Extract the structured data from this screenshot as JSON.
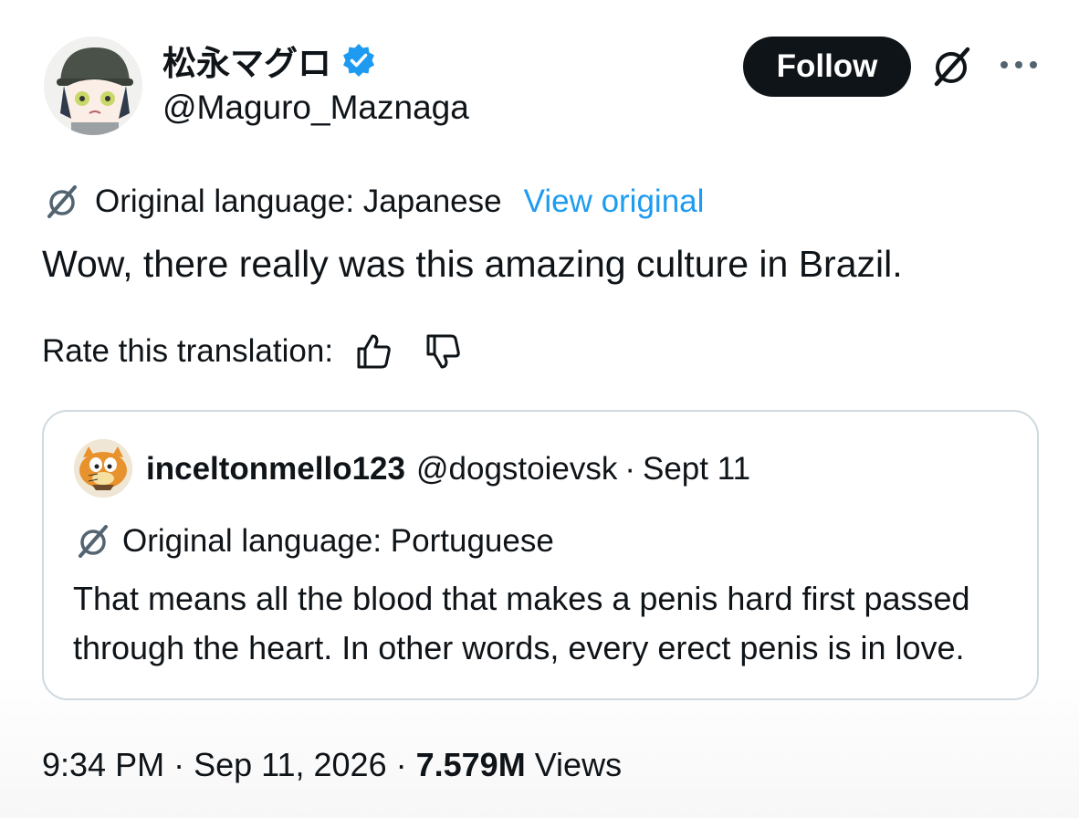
{
  "author": {
    "display_name": "松永マグロ",
    "handle": "@Maguro_Maznaga",
    "verified": true
  },
  "header": {
    "follow_label": "Follow",
    "icons": [
      "grok-translate-icon",
      "more-options-icon"
    ]
  },
  "translation": {
    "original_language_label": "Original language: Japanese",
    "view_original_label": "View original"
  },
  "tweet": {
    "text": "Wow, there really was this amazing culture in Brazil."
  },
  "rating": {
    "label": "Rate this translation:",
    "icons": [
      "thumbs-up-icon",
      "thumbs-down-icon"
    ]
  },
  "quoted_tweet": {
    "display_name": "inceltonmello123",
    "handle": "@dogstoievsk",
    "separator": "·",
    "date": "Sept 11",
    "original_language_label": "Original language: Portuguese",
    "text": "That means all the blood that makes a penis hard first passed through the heart. In other words, every erect penis is in love."
  },
  "meta": {
    "time": "9:34 PM",
    "separator": "·",
    "date": "Sep 11, 2026",
    "views_count": "7.579M",
    "views_label": "Views"
  },
  "colors": {
    "link": "#1d9bf0",
    "verified_badge": "#1d9bf0",
    "follow_bg": "#0f1419",
    "border": "#cfd9de"
  }
}
